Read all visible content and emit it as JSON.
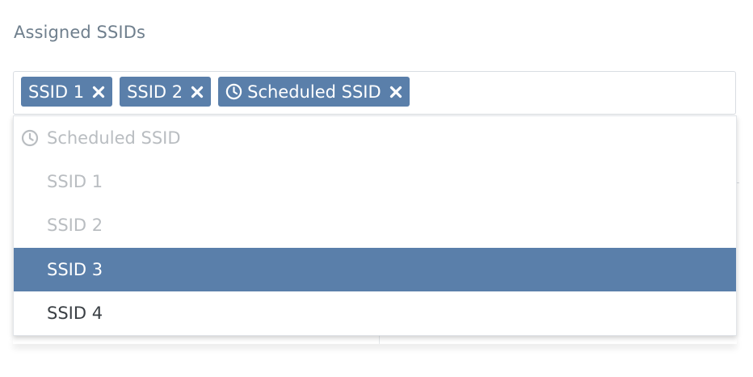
{
  "field": {
    "label": "Assigned SSIDs"
  },
  "selected_chips": [
    {
      "label": "SSID 1",
      "scheduled": false,
      "remove_icon": "close-icon"
    },
    {
      "label": "SSID 2",
      "scheduled": false,
      "remove_icon": "close-icon"
    },
    {
      "label": "Scheduled SSID",
      "scheduled": true,
      "icon": "clock-icon",
      "remove_icon": "close-icon"
    }
  ],
  "dropdown": {
    "options": [
      {
        "label": "Scheduled SSID",
        "state": "disabled",
        "icon": "clock-icon"
      },
      {
        "label": "SSID 1",
        "state": "disabled"
      },
      {
        "label": "SSID 2",
        "state": "disabled"
      },
      {
        "label": "SSID 3",
        "state": "highlighted"
      },
      {
        "label": "SSID 4",
        "state": "normal"
      }
    ]
  },
  "colors": {
    "accent": "#5a7faa",
    "label_text": "#6f7f8d",
    "disabled_text": "#b9bdc1",
    "option_text": "#3a3f44"
  }
}
